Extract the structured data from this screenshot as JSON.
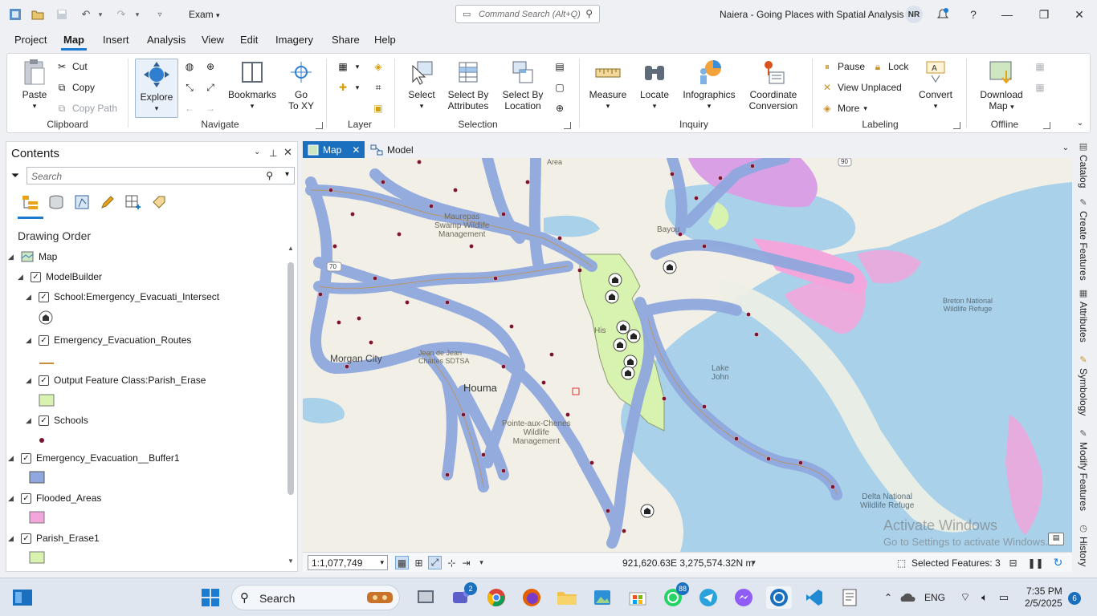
{
  "titlebar": {
    "project_name": "Exam",
    "command_search_placeholder": "Command Search (Alt+Q)",
    "app_title": "Naiera - Going Places with Spatial Analysis",
    "user_initials": "NR"
  },
  "menu_tabs": [
    "Project",
    "Map",
    "Insert",
    "Analysis",
    "View",
    "Edit",
    "Imagery",
    "Share",
    "Help"
  ],
  "active_menu_tab": "Map",
  "ribbon": {
    "clipboard": {
      "paste": "Paste",
      "cut": "Cut",
      "copy": "Copy",
      "copy_path": "Copy Path",
      "group": "Clipboard"
    },
    "navigate": {
      "explore": "Explore",
      "bookmarks": "Bookmarks",
      "go_to": "Go",
      "go_to_2": "To XY",
      "group": "Navigate"
    },
    "layer": {
      "group": "Layer"
    },
    "selection": {
      "select": "Select",
      "select_by_attributes_1": "Select By",
      "select_by_attributes_2": "Attributes",
      "select_by_location_1": "Select By",
      "select_by_location_2": "Location",
      "group": "Selection"
    },
    "inquiry": {
      "measure": "Measure",
      "locate": "Locate",
      "infographics": "Infographics",
      "coordinate_conversion_1": "Coordinate",
      "coordinate_conversion_2": "Conversion",
      "group": "Inquiry"
    },
    "labeling": {
      "pause": "Pause",
      "lock": "Lock",
      "view_unplaced": "View Unplaced",
      "more": "More",
      "convert": "Convert",
      "group": "Labeling"
    },
    "offline": {
      "download_map_1": "Download",
      "download_map_2": "Map",
      "group": "Offline"
    }
  },
  "contents": {
    "title": "Contents",
    "search_placeholder": "Search",
    "drawing_order": "Drawing Order",
    "layers": [
      {
        "label": "Map"
      },
      {
        "label": "ModelBuilder"
      },
      {
        "label": "School:Emergency_Evacuati_Intersect"
      },
      {
        "label": "Emergency_Evacuation_Routes"
      },
      {
        "label": "Output Feature Class:Parish_Erase"
      },
      {
        "label": "Schools"
      },
      {
        "label": "Emergency_Evacuation__Buffer1"
      },
      {
        "label": "Flooded_Areas"
      },
      {
        "label": "Parish_Erase1"
      }
    ]
  },
  "view_tabs": {
    "map": "Map",
    "model": "Model"
  },
  "map_labels": {
    "maurepas": "Maurepas",
    "swamp_wildlife": "Swamp Wildlife",
    "management": "Management",
    "bayou": "Bayou",
    "breton_1": "Breton National",
    "breton_2": "Wildlife Refuge",
    "morgan_city": "Morgan City",
    "houma": "Houma",
    "jean_1": "Jean de Jean",
    "jean_2": "Charles SDTSA",
    "pointe_1": "Pointe-aux-Chenes",
    "pointe_2": "Wildlife",
    "pointe_3": "Management",
    "lake_1": "Lake",
    "lake_2": "John",
    "delta_1": "Delta National",
    "delta_2": "Wildlife Refuge",
    "area": "Area",
    "route_90": "90",
    "route_70": "70",
    "hist": "His"
  },
  "map_status": {
    "scale": "1:1,077,749",
    "coordinates": "921,620.63E 3,275,574.32N m",
    "selected_features": "Selected Features: 3"
  },
  "side_dock": [
    "Catalog",
    "Create Features",
    "Attributes",
    "Symbology",
    "Modify Features",
    "History"
  ],
  "watermark": {
    "line1": "Activate Windows",
    "line2": "Go to Settings to activate Windows."
  },
  "taskbar": {
    "search_placeholder": "Search",
    "teams_badge": "2",
    "whatsapp_badge": "88",
    "language": "ENG",
    "time": "7:35 PM",
    "date": "2/5/2025",
    "notifications": "6"
  },
  "colors": {
    "accent": "#1b7bd1",
    "buffer_fill": "#8fa8de",
    "flooded_fill": "#f2a6dc",
    "parish_fill": "#d8f2b0",
    "school_point": "#7a1530",
    "water": "#a9d1ea",
    "land": "#f2efe7"
  }
}
